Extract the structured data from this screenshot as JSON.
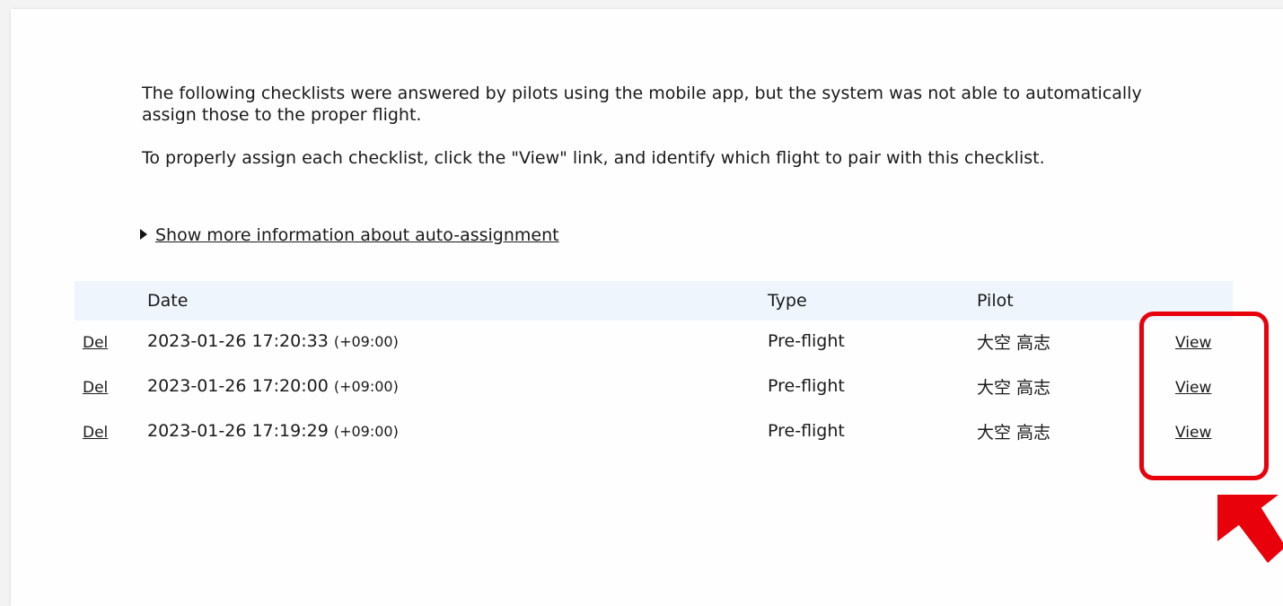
{
  "intro": {
    "paragraph1": "The following checklists were answered by pilots using the mobile app, but the system was not able to automatically assign those to the proper flight.",
    "paragraph2": "To properly assign each checklist, click the \"View\" link, and identify which flight to pair with this checklist."
  },
  "more_info_label": "Show more information about auto-assignment",
  "table": {
    "headers": {
      "date": "Date",
      "type": "Type",
      "pilot": "Pilot"
    },
    "rows": [
      {
        "del": "Del",
        "date": "2023-01-26 17:20:33",
        "tz": "(+09:00)",
        "type": "Pre-flight",
        "pilot": "大空 高志",
        "view": "View"
      },
      {
        "del": "Del",
        "date": "2023-01-26 17:20:00",
        "tz": "(+09:00)",
        "type": "Pre-flight",
        "pilot": "大空 高志",
        "view": "View"
      },
      {
        "del": "Del",
        "date": "2023-01-26 17:19:29",
        "tz": "(+09:00)",
        "type": "Pre-flight",
        "pilot": "大空 高志",
        "view": "View"
      }
    ]
  },
  "annotation": {
    "color": "#e8000b"
  }
}
